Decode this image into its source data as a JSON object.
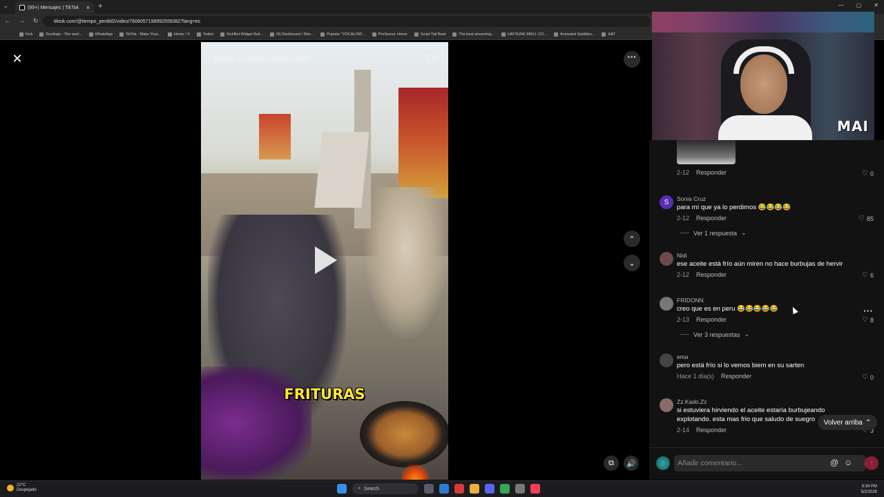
{
  "browser": {
    "tab_title": "(99+) Mensajes | TikTok",
    "url": "tiktok.com/@tiempo_perdid2/video/7606057198992559382?lang=es",
    "bookmarks": [
      "Kick",
      "Duolingo - The worl...",
      "WhatsApp",
      "TikTok - Make Your...",
      "Home / X",
      "Twitch",
      "KickBot Widget Buil...",
      "(5) Dashboard / Stre...",
      "Popular \"VOCALOID...",
      "PreSonus: Home",
      "Script Tail Beat",
      "The best streaming...",
      "HATSUNE MIKU: CO...",
      "Animated Subtitles...",
      "HAT"
    ]
  },
  "video": {
    "search_placeholder": "Buscar contenido relacionado",
    "caption": "FRITURAS"
  },
  "overlay": {
    "webcam_logo": "MAI"
  },
  "comments": [
    {
      "user": "",
      "text": "",
      "date": "2-12",
      "reply": "Responder",
      "likes": "0",
      "avatar": ""
    },
    {
      "user": "Sonia Cruz",
      "text": "para mí que ya lo perdimos 😂😂😂😂",
      "date": "2-12",
      "reply": "Responder",
      "likes": "85",
      "avatar": "S",
      "replies": "Ver 1 respuesta"
    },
    {
      "user": "Nidi",
      "text": "ese aceite está frío aún miren no hace burbujas de hervir",
      "date": "2-12",
      "reply": "Responder",
      "likes": "6",
      "avatar": ""
    },
    {
      "user": "FRIDONN",
      "text": "creo que es en peru 😂😂😂😂😂",
      "date": "2-13",
      "reply": "Responder",
      "likes": "8",
      "avatar": "",
      "replies": "Ver 3 respuestas"
    },
    {
      "user": "ema",
      "text": "pero está frío si lo vemos biem en su sarten",
      "date": "Hace 1 día(s)",
      "reply": "Responder",
      "likes": "0",
      "avatar": ""
    },
    {
      "user": "Zz.Kado.Zz",
      "text": "si estuviera hirviendo el aceite estaría burbujeando",
      "text2": "explotando. esta mas frio que saludo de suegro",
      "date": "2-14",
      "reply": "Responder",
      "likes": "3",
      "avatar": ""
    }
  ],
  "back_to_top": "Volver arriba",
  "comment_input": {
    "placeholder": "Añadir comentario..."
  },
  "taskbar": {
    "temperature": "22°C",
    "weather": "Despejado",
    "search": "Search",
    "time": "9:34 PM",
    "date": "5/2/2026"
  },
  "colors": {
    "accent": "#fe2c55",
    "caption": "#ffe53b"
  }
}
